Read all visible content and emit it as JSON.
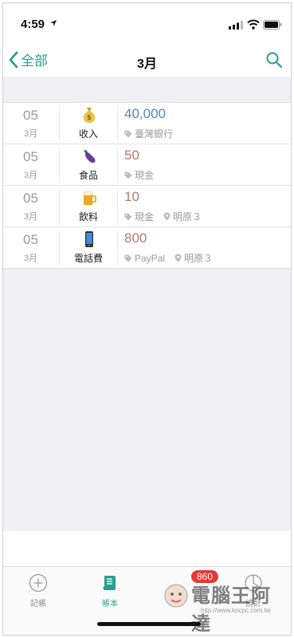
{
  "status_bar": {
    "time": "4:59"
  },
  "nav": {
    "back_label": "全部",
    "title": "3月"
  },
  "entries": [
    {
      "day": "05",
      "month": "3月",
      "category": "收入",
      "icon": "money-bag-icon",
      "amount": "40,000",
      "amount_color": "#4a8bc2",
      "account": "臺灣銀行",
      "location": ""
    },
    {
      "day": "05",
      "month": "3月",
      "category": "食品",
      "icon": "eggplant-icon",
      "amount": "50",
      "amount_color": "#b07a6a",
      "account": "現金",
      "location": ""
    },
    {
      "day": "05",
      "month": "3月",
      "category": "飲料",
      "icon": "beer-icon",
      "amount": "10",
      "amount_color": "#b07a6a",
      "account": "現金",
      "location": "明原３"
    },
    {
      "day": "05",
      "month": "3月",
      "category": "電話費",
      "icon": "phone-icon",
      "amount": "800",
      "amount_color": "#b07a6a",
      "account": "PayPal",
      "location": "明原３"
    }
  ],
  "tabbar": {
    "record_label": "記帳",
    "book_label": "帳本",
    "stats_label": "統計",
    "badge": "860"
  },
  "watermark": {
    "name": "電腦王阿達",
    "url": "http://www.kocpc.com.tw"
  },
  "colors": {
    "accent": "#2a9d8f",
    "income": "#4a8bc2",
    "expense": "#b07a6a"
  }
}
